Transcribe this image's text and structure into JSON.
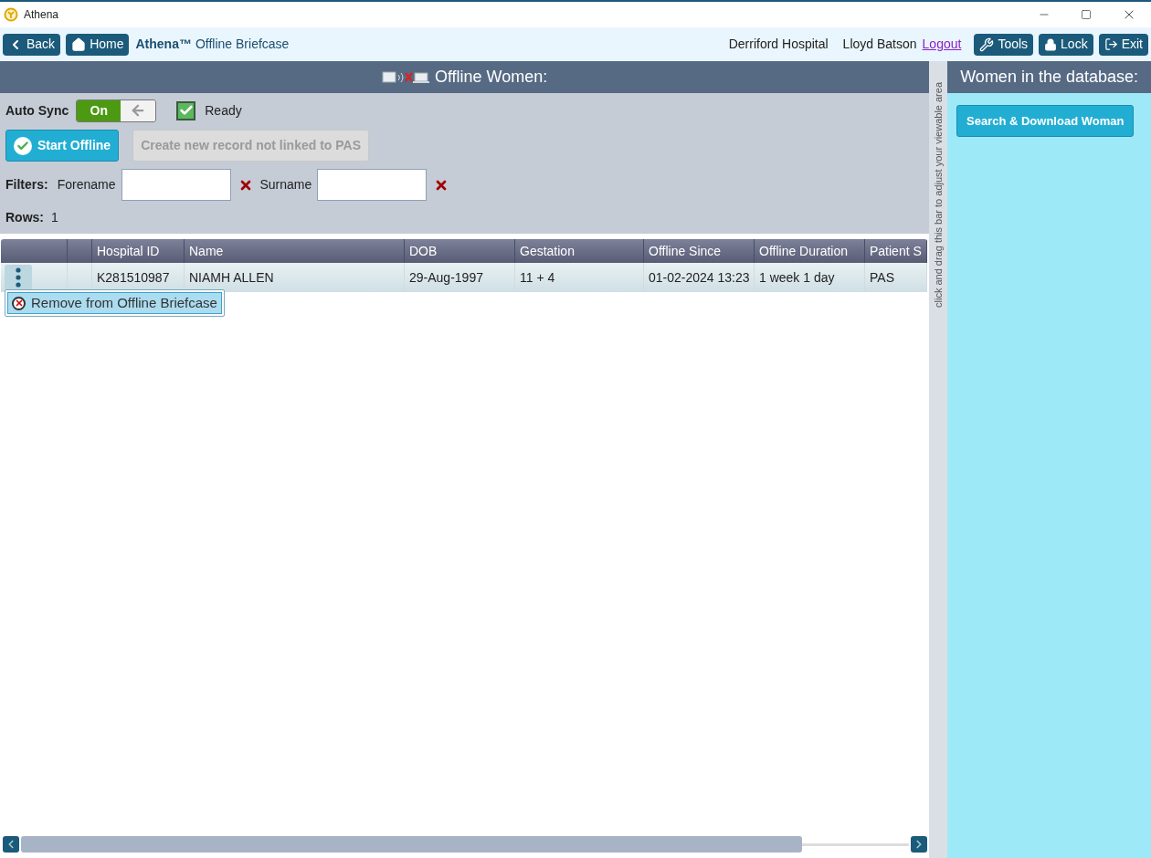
{
  "window": {
    "title": "Athena"
  },
  "toolbar": {
    "back": "Back",
    "home": "Home",
    "app_name": "Athena™",
    "page": "Offline Briefcase",
    "hospital": "Derriford Hospital",
    "user": "Lloyd Batson",
    "logout": "Logout",
    "tools": "Tools",
    "lock": "Lock",
    "exit": "Exit"
  },
  "offline_panel": {
    "title": "Offline Women:",
    "auto_sync": {
      "label": "Auto Sync",
      "on": true,
      "on_label": "On"
    },
    "status": {
      "label": "Ready",
      "checked": true
    },
    "buttons": [
      {
        "label": "Start Offline",
        "disabled": false,
        "kind": "check"
      },
      {
        "label": "Create new record not linked to PAS",
        "disabled": true,
        "kind": "plain"
      }
    ],
    "filters": {
      "label": "Filters:",
      "fields": [
        {
          "label": "Forename"
        },
        {
          "label": "Surname"
        }
      ]
    },
    "rows_label": "Rows:",
    "rows_count": "1"
  },
  "table": {
    "columns": [
      "Hospital ID",
      "Name",
      "DOB",
      "Gestation",
      "Offline Since",
      "Offline Duration",
      "Patient S"
    ],
    "rows": [
      {
        "selected": true,
        "cells": [
          "K281510987",
          "NIAMH ALLEN",
          "29-Aug-1997",
          "11 + 4",
          "01-02-2024 13:23",
          "1 week 1 day",
          "PAS"
        ]
      }
    ]
  },
  "context_menu": {
    "items": [
      "Remove from Offline Briefcase"
    ]
  },
  "splitter": {
    "hint": "click and drag this bar to adjust your viewable area"
  },
  "database_panel": {
    "title": "Women in the database:",
    "button": "Search & Download Woman"
  }
}
